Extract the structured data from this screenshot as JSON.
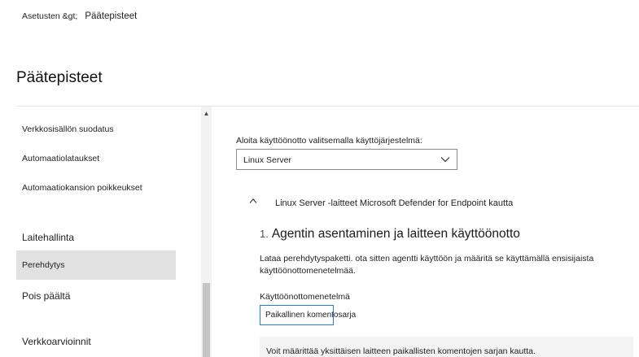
{
  "breadcrumb": {
    "parent": "Asetusten &gt;",
    "current": "Päätepisteet"
  },
  "page_title": "Päätepisteet",
  "sidebar": {
    "items": [
      {
        "label": "Verkkosisällön suodatus"
      },
      {
        "label": "Automaatiolataukset"
      },
      {
        "label": "Automaatiokansion poikkeukset"
      },
      {
        "label": "Laitehallinta"
      },
      {
        "label": "Perehdytys",
        "selected": true
      },
      {
        "label": "Pois päältä"
      },
      {
        "label": "Verkkoarvioinnit"
      }
    ]
  },
  "main": {
    "os_label": "Aloita käyttöönotto valitsemalla käyttöjärjestelmä:",
    "os_select_value": "Linux Server",
    "section_title": "Linux Server -laitteet Microsoft Defender for Endpoint kautta",
    "step": {
      "number": "1.",
      "title": "Agentin asentaminen ja laitteen käyttöönotto",
      "description": "Lataa perehdytyspaketti. ota sitten agentti käyttöön ja määritä se käyttämällä ensisijaista käyttöönottomenetelmää."
    },
    "method_label": "Käyttöönottomenetelmä",
    "method_value": "Paikallinen komentosarja",
    "info_text": "Voit määrittää yksittäisen laitteen paikallisten komentojen sarjan kautta."
  },
  "icons": {
    "select_chevron": "chevron-down-icon",
    "section_chevron": "chevron-up-icon",
    "scroll_up": "scroll-up-arrow-icon"
  },
  "colors": {
    "selected_bg": "#e1e1e1",
    "focus_border": "#2b7bd6",
    "info_bg": "#f3f3f3"
  }
}
